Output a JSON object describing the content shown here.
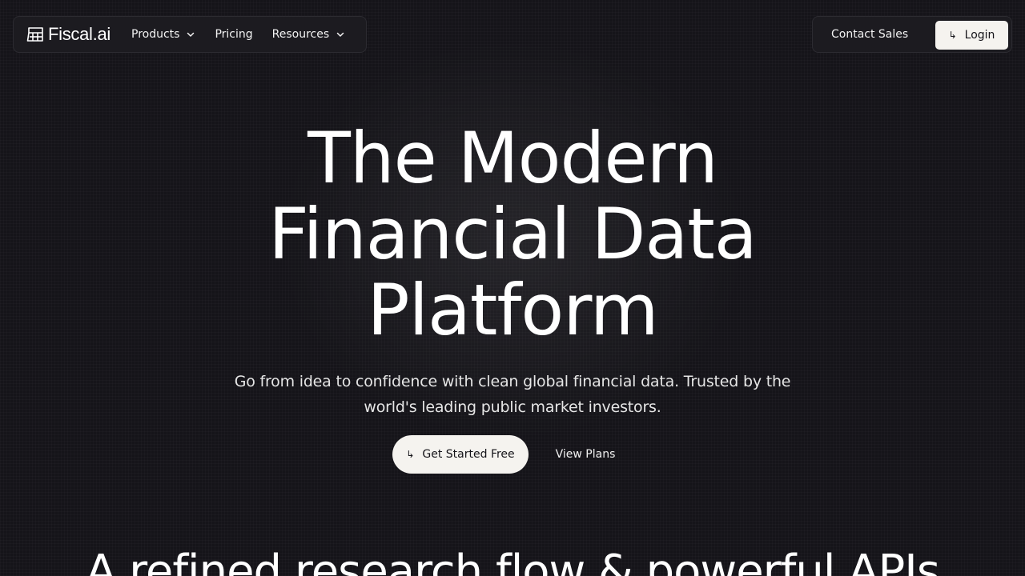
{
  "nav": {
    "logo_text": "Fiscal.ai",
    "logo_icon": "fiscal-logo-icon",
    "items": [
      {
        "label": "Products",
        "has_dropdown": true
      },
      {
        "label": "Pricing",
        "has_dropdown": false
      },
      {
        "label": "Resources",
        "has_dropdown": true
      }
    ],
    "contact_label": "Contact Sales",
    "login_label": "Login",
    "login_icon": "↳"
  },
  "hero": {
    "title_lines": [
      "The Modern",
      "Financial Data",
      "Platform"
    ],
    "subtitle_lines": [
      "Go from idea to confidence with clean global financial data. Trusted by the",
      "world's leading public market investors."
    ],
    "cta_primary_icon": "↳",
    "cta_primary_label": "Get Started Free",
    "cta_secondary_label": "View Plans"
  },
  "section": {
    "heading": "A refined research flow & powerful APIs"
  },
  "colors": {
    "background": "#151419",
    "surface": "#1c1b20",
    "border": "#2c2b31",
    "button_light": "#f5f3ef",
    "text": "#ffffff"
  }
}
